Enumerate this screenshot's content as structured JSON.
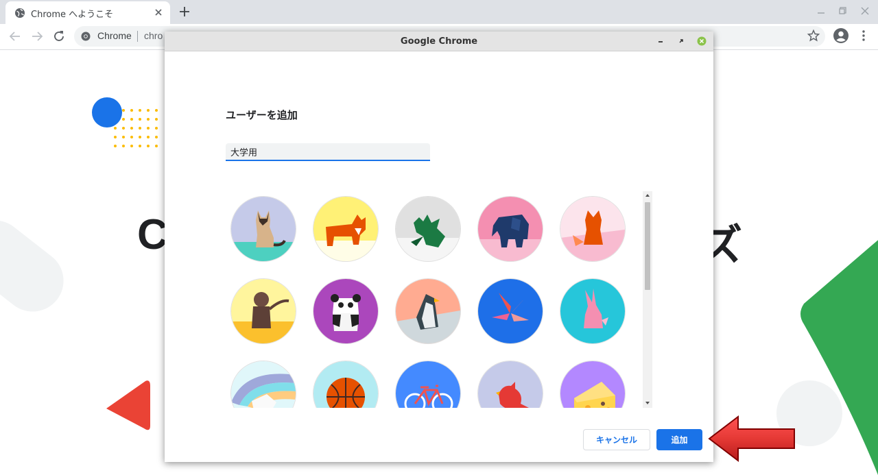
{
  "browser": {
    "tab_title": "Chrome へようこそ",
    "omnibox": {
      "site_label": "Chrome",
      "url_partial": "chro"
    }
  },
  "background_page": {
    "heading_left": "C",
    "heading_right": "ズ"
  },
  "dialog": {
    "window_title": "Google Chrome",
    "heading": "ユーザーを追加",
    "name_input": {
      "value": "大学用"
    },
    "avatars": [
      {
        "name": "cat-icon",
        "bg": "#c5cae9"
      },
      {
        "name": "corgi-icon",
        "bg": "#fff176"
      },
      {
        "name": "dragon-icon",
        "bg": "#e0e0e0"
      },
      {
        "name": "elephant-icon",
        "bg": "#f48fb1"
      },
      {
        "name": "fox-icon",
        "bg": "#fce4ec"
      },
      {
        "name": "monkey-icon",
        "bg": "#fff59d"
      },
      {
        "name": "panda-icon",
        "bg": "#ab47bc"
      },
      {
        "name": "penguin-icon",
        "bg": "#ffab91"
      },
      {
        "name": "butterfly-icon",
        "bg": "#1e6fe8"
      },
      {
        "name": "rabbit-icon",
        "bg": "#26c6da"
      },
      {
        "name": "unicorn-icon",
        "bg": "#b3e5fc"
      },
      {
        "name": "basketball-icon",
        "bg": "#b2ebf2"
      },
      {
        "name": "bicycle-icon",
        "bg": "#448aff"
      },
      {
        "name": "bird-icon",
        "bg": "#c5cae9"
      },
      {
        "name": "cheese-icon",
        "bg": "#b388ff"
      }
    ],
    "buttons": {
      "cancel": "キャンセル",
      "add": "追加"
    }
  },
  "colors": {
    "accent": "#1a73e8",
    "arrow": "#e53935"
  }
}
